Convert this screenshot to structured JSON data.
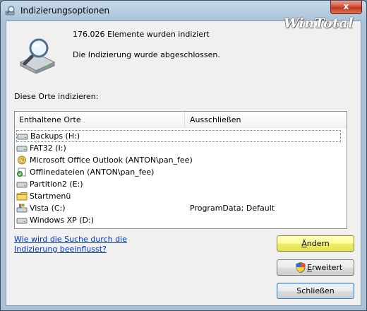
{
  "window": {
    "title": "Indizierungsoptionen",
    "close_glyph": "x",
    "watermark": "WinTotal",
    "title_icon": "indexing-options-icon"
  },
  "summary": {
    "items_indexed": "176.026 Elemente wurden indiziert",
    "status": "Die Indizierung wurde abgeschlossen.",
    "icon": "magnifier-drive-icon"
  },
  "locations": {
    "label": "Diese Orte indizieren:",
    "columns": [
      "Enthaltene Orte",
      "Ausschließen"
    ],
    "rows": [
      {
        "name": "Backups (H:)",
        "exclude": "",
        "icon": "drive-icon",
        "selected": true
      },
      {
        "name": "FAT32 (I:)",
        "exclude": "",
        "icon": "drive-icon"
      },
      {
        "name": "Microsoft Office Outlook (ANTON\\pan_fee)",
        "exclude": "",
        "icon": "outlook-icon"
      },
      {
        "name": "Offlinedateien (ANTON\\pan_fee)",
        "exclude": "",
        "icon": "offline-files-icon"
      },
      {
        "name": "Partition2 (E:)",
        "exclude": "",
        "icon": "drive-icon"
      },
      {
        "name": "Startmenü",
        "exclude": "",
        "icon": "folder-icon"
      },
      {
        "name": "Vista (C:)",
        "exclude": "ProgramData; Default",
        "icon": "windows-drive-icon"
      },
      {
        "name": "Windows XP (D:)",
        "exclude": "",
        "icon": "drive-icon"
      }
    ]
  },
  "help": {
    "link_text": "Wie wird die Suche durch die Indizierung beeinflusst?"
  },
  "buttons": {
    "change": {
      "mnemonic": "Ä",
      "rest": "ndern"
    },
    "advanced": {
      "mnemonic": "E",
      "rest": "rweitert",
      "icon": "shield-icon"
    },
    "close": "Schließen"
  },
  "colors": {
    "change_button": "#ffff9a",
    "link": "#0033cc",
    "close_button": "#c2361d"
  }
}
